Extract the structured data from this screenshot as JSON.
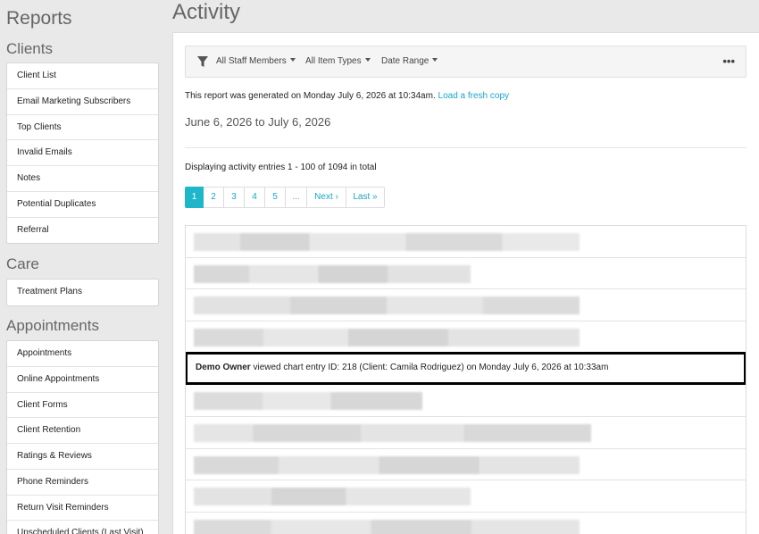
{
  "sidebar": {
    "title": "Reports",
    "sections": [
      {
        "heading": "Clients",
        "items": [
          "Client List",
          "Email Marketing Subscribers",
          "Top Clients",
          "Invalid Emails",
          "Notes",
          "Potential Duplicates",
          "Referral"
        ]
      },
      {
        "heading": "Care",
        "items": [
          "Treatment Plans"
        ]
      },
      {
        "heading": "Appointments",
        "items": [
          "Appointments",
          "Online Appointments",
          "Client Forms",
          "Client Retention",
          "Ratings & Reviews",
          "Phone Reminders",
          "Return Visit Reminders",
          "Unscheduled Clients (Last Visit)"
        ]
      }
    ]
  },
  "main": {
    "title": "Activity",
    "filters": {
      "icon": "filter-icon",
      "staff": "All Staff Members",
      "item_types": "All Item Types",
      "date_range": "Date Range",
      "more": "•••"
    },
    "generated_text": "This report was generated on Monday July 6, 2026 at 10:34am.",
    "refresh_link": "Load a fresh copy",
    "date_range_text": "June 6, 2026 to July 6, 2026",
    "displaying_text": "Displaying activity entries 1 - 100 of 1094 in total",
    "pagination": [
      "1",
      "2",
      "3",
      "4",
      "5",
      "...",
      "Next ›",
      "Last »"
    ],
    "highlighted_entry": {
      "actor": "Demo Owner",
      "text": " viewed chart entry ID: 218 (Client: Camila Rodriguez) on Monday July 6, 2026 at 10:33am"
    }
  }
}
